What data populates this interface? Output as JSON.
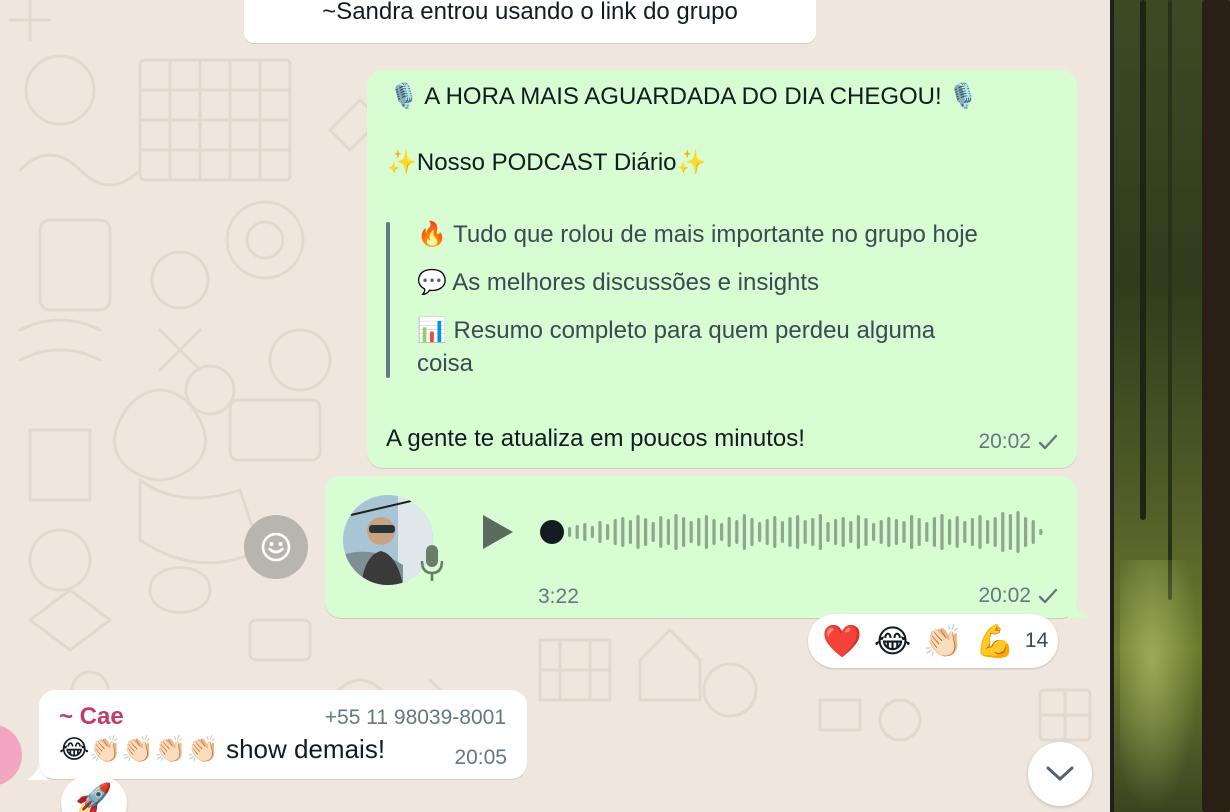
{
  "system_message": "~Sandra entrou usando o link do grupo",
  "podcast_message": {
    "headline": "🎙️  A HORA MAIS AGUARDADA DO DIA CHEGOU!  🎙️",
    "subtitle": "✨Nosso PODCAST Diário✨",
    "quote_lines": [
      "🔥 Tudo que rolou de mais importante no grupo hoje",
      "💬 As melhores discussões e insights",
      "📊 Resumo completo para quem perdeu alguma",
      "coisa"
    ],
    "closing": "A gente te atualiza em poucos minutos!",
    "time": "20:02",
    "status_icon": "single-check-icon"
  },
  "voice_message": {
    "duration": "3:22",
    "time": "20:02",
    "progress": 0,
    "status_icon": "single-check-icon",
    "icons": [
      "play-icon",
      "mic-icon"
    ]
  },
  "reactions": {
    "emojis": [
      "❤️",
      "😂",
      "👏🏻",
      "💪"
    ],
    "count": "14"
  },
  "incoming_message": {
    "sender": "~ Cae",
    "phone": "+55 11 98039-8001",
    "text": "😂👏🏻👏🏻👏🏻👏🏻 show demais!",
    "time": "20:05",
    "sender_color": "#c23b6d"
  },
  "rocket_reaction": "🚀",
  "colors": {
    "outgoing_bubble": "#d9fdd3",
    "incoming_bubble": "#ffffff",
    "chat_background": "#efe7dd",
    "meta_text": "#667781"
  }
}
